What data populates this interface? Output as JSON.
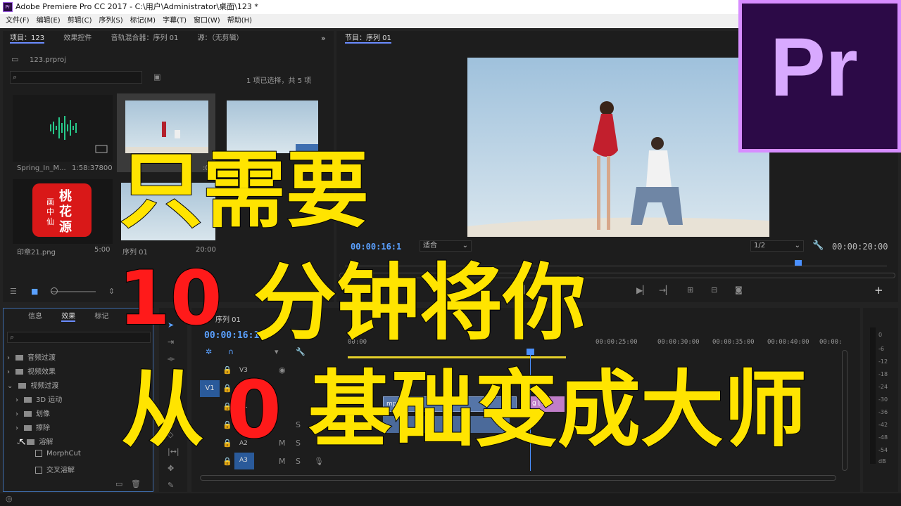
{
  "window": {
    "title": "Adobe Premiere Pro CC 2017 - C:\\用户\\Administrator\\桌面\\123 *",
    "icon": "Pr"
  },
  "menu": [
    "文件(F)",
    "编辑(E)",
    "剪辑(C)",
    "序列(S)",
    "标记(M)",
    "字幕(T)",
    "窗口(W)",
    "帮助(H)"
  ],
  "project_panel": {
    "tabs": [
      "项目：123",
      "效果控件",
      "音轨混合器：序列 01",
      "源：（无剪辑）"
    ],
    "project_file": "123.prproj",
    "selection_info": "1 项已选择，共 5 项",
    "search_placeholder": "",
    "items": [
      {
        "name": "Spring_In_M...",
        "duration": "1:58:37800"
      },
      {
        "name": "",
        "duration": ""
      },
      {
        "name": "",
        "duration": ""
      },
      {
        "name": "印章21.png",
        "duration": "5:00"
      },
      {
        "name": "序列 01",
        "duration": "20:00"
      }
    ],
    "seal_text": [
      "桃",
      "花",
      "源"
    ],
    "seal_small": [
      "画",
      "中",
      "仙"
    ]
  },
  "program_monitor": {
    "tab": "节目：序列 01",
    "timecode": "00:00:16:1",
    "fit": "适合",
    "resolution": "1/2",
    "duration": "00:00:20:00"
  },
  "effects_panel": {
    "tabs": [
      "信息",
      "效果",
      "标记"
    ],
    "tree": [
      {
        "label": "音频过渡",
        "level": 0,
        "type": "folder"
      },
      {
        "label": "视频效果",
        "level": 0,
        "type": "folder"
      },
      {
        "label": "视频过渡",
        "level": 0,
        "type": "folder"
      },
      {
        "label": "3D 运动",
        "level": 1,
        "type": "folder"
      },
      {
        "label": "划像",
        "level": 1,
        "type": "folder"
      },
      {
        "label": "擦除",
        "level": 1,
        "type": "folder"
      },
      {
        "label": "溶解",
        "level": 1,
        "type": "folder"
      },
      {
        "label": "MorphCut",
        "level": 2,
        "type": "effect"
      },
      {
        "label": "交叉溶解",
        "level": 2,
        "type": "effect"
      }
    ]
  },
  "timeline": {
    "tab": "序列 01",
    "timecode": "00:00:16:17",
    "ruler": [
      "00:00",
      "00:00:25:00",
      "00:00:30:00",
      "00:00:35:00",
      "00:00:40:00",
      "00:00:"
    ],
    "tracks": [
      "V3",
      "V2",
      "V1",
      "A1",
      "A2",
      "A3"
    ],
    "source_patch": "V1",
    "clip_video": "mp4 [V]",
    "clip_pink": "g [V]",
    "meter_db": [
      "0",
      "-6",
      "-12",
      "-18",
      "-24",
      "-30",
      "-36",
      "-42",
      "-48",
      "-54",
      "dB"
    ]
  },
  "overlay": {
    "line1": "只需要",
    "line2_num": "10",
    "line2_text": "分钟将你",
    "line3_a": "从",
    "line3_num": "0",
    "line3_text": "基础变成大师",
    "logo": "Pr"
  },
  "colors": {
    "overlay_yellow": "#ffe400",
    "overlay_red": "#ff1a1a",
    "timecode_blue": "#5aa0ff",
    "pr_purple": "#d8a9ff"
  }
}
